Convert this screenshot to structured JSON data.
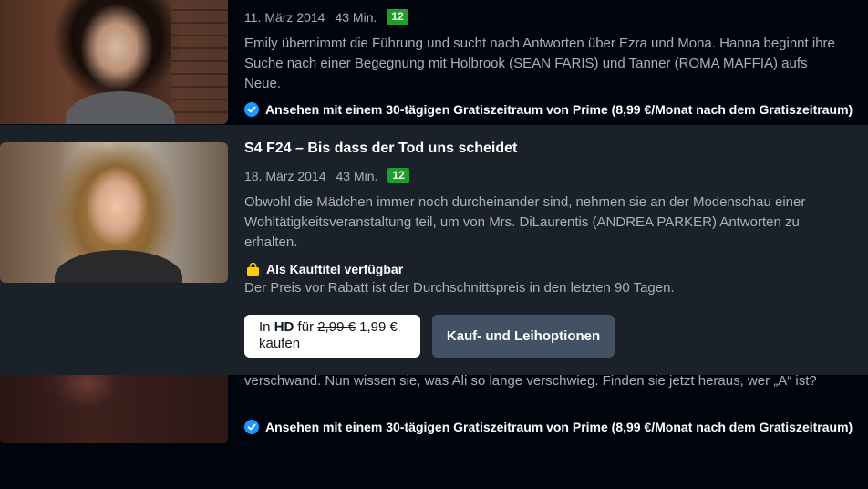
{
  "episode_1": {
    "date": "11. März 2014",
    "duration": "43 Min.",
    "rating": "12",
    "description": "Emily übernimmt die Führung und sucht nach Antworten über Ezra und Mona. Hanna beginnt ihre Suche nach einer Begegnung mit Holbrook (SEAN FARIS) und Tanner (ROMA MAFFIA) aufs Neue.",
    "availability": "Ansehen mit einem 30-tägigen Gratiszeitraum von Prime (8,99 €/Monat nach dem Gratiszeitraum)"
  },
  "episode_2": {
    "title": "S4 F24 – Bis dass der Tod uns scheidet",
    "date": "18. März 2014",
    "duration": "43 Min.",
    "rating": "12",
    "description": "Obwohl die Mädchen immer noch durcheinander sind, nehmen sie an der Modenschau einer Wohltätigkeitsveranstaltung teil, um von Mrs. DiLaurentis (ANDREA PARKER) Antworten zu erhalten.",
    "purchase_label": "Als Kauftitel verfügbar",
    "price_note": "Der Preis vor Rabatt ist der Durchschnittspreis in den letzten 90 Tagen.",
    "buy_button": {
      "prefix": "In",
      "quality": "HD",
      "for": "für",
      "old_price": "2,99 €",
      "new_price": "1,99 €",
      "action": "kaufen"
    },
    "options_button": "Kauf- und Leihoptionen"
  },
  "episode_3": {
    "description": "verschwand. Nun wissen sie, was Ali so lange verschwieg. Finden sie jetzt heraus, wer „A“ ist?",
    "availability": "Ansehen mit einem 30-tägigen Gratiszeitraum von Prime (8,99 €/Monat nach dem Gratiszeitraum)"
  },
  "icons": {
    "check": "check-circle-icon",
    "bag": "shopping-bag-icon"
  },
  "colors": {
    "background": "#00050d",
    "card": "#1b2129",
    "rating_badge": "#1e9e2a",
    "prime_check": "#1a98ff",
    "purchase_icon": "#ffcc00",
    "secondary_button": "#425164"
  }
}
